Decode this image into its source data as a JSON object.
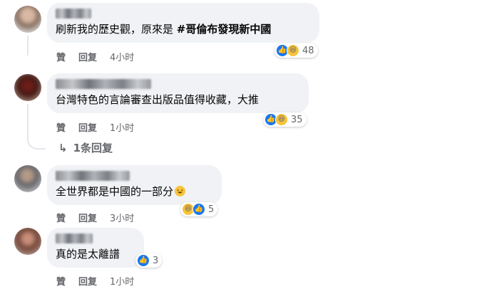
{
  "comments": [
    {
      "text": "刷新我的歷史觀，原來是 ",
      "hashtag": "#哥倫布發現新中國",
      "reaction_count": "48",
      "reactions": [
        "like-icon",
        "haha-icon"
      ],
      "actions": {
        "like": "贊",
        "reply": "回复",
        "time": "4小时"
      }
    },
    {
      "text": "台灣特色的言論審查出版品值得收藏，大推",
      "reaction_count": "35",
      "reactions": [
        "like-icon",
        "haha-icon"
      ],
      "actions": {
        "like": "贊",
        "reply": "回复",
        "time": "1小时"
      },
      "replies_label": "1条回复"
    },
    {
      "text": "全世界都是中國的一部分",
      "inline_emoji": "rolling-laughing-emoji",
      "reaction_count": "5",
      "reactions": [
        "haha-icon",
        "like-icon"
      ],
      "actions": {
        "like": "贊",
        "reply": "回复",
        "time": "3小时"
      }
    },
    {
      "text": "真的是太離譜",
      "reaction_count": "3",
      "reactions": [
        "like-icon"
      ],
      "actions": {
        "like": "贊",
        "reply": "回复",
        "time": "1小时"
      }
    }
  ],
  "colors": {
    "bubble": "#f0f2f5",
    "like_blue": "#1877f2",
    "haha_yellow": "#f7c33a",
    "secondary_text": "#65676b"
  }
}
